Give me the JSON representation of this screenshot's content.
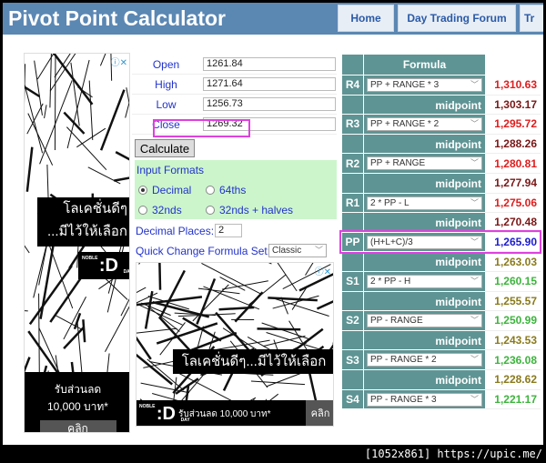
{
  "header": {
    "title": "Pivot Point Calculator",
    "nav": [
      "Home",
      "Day Trading Forum",
      "Tr"
    ]
  },
  "form": {
    "fields": [
      {
        "label": "Open",
        "value": "1261.84"
      },
      {
        "label": "High",
        "value": "1271.64"
      },
      {
        "label": "Low",
        "value": "1256.73"
      },
      {
        "label": "Close",
        "value": "1269.32"
      }
    ],
    "calculate": "Calculate",
    "input_formats": "Input Formats",
    "formats": [
      {
        "label": "Decimal",
        "selected": true
      },
      {
        "label": "64ths",
        "selected": false
      },
      {
        "label": "32nds",
        "selected": false
      },
      {
        "label": "32nds + halves",
        "selected": false
      }
    ],
    "decimal_places_label": "Decimal Places:",
    "decimal_places": "2",
    "formula_set_label": "Quick Change Formula Set:",
    "formula_set": "Classic"
  },
  "pivot": {
    "header": "Formula",
    "rows": [
      {
        "label": "R4",
        "formula": "PP + RANGE * 3",
        "value": "1,310.63",
        "kind": "res"
      },
      {
        "label": "",
        "formula": "midpoint",
        "value": "1,303.17",
        "kind": "midup"
      },
      {
        "label": "R3",
        "formula": "PP + RANGE * 2",
        "value": "1,295.72",
        "kind": "res"
      },
      {
        "label": "",
        "formula": "midpoint",
        "value": "1,288.26",
        "kind": "midup"
      },
      {
        "label": "R2",
        "formula": "PP + RANGE",
        "value": "1,280.81",
        "kind": "res"
      },
      {
        "label": "",
        "formula": "midpoint",
        "value": "1,277.94",
        "kind": "midup"
      },
      {
        "label": "R1",
        "formula": "2 * PP - L",
        "value": "1,275.06",
        "kind": "res"
      },
      {
        "label": "",
        "formula": "midpoint",
        "value": "1,270.48",
        "kind": "midup"
      },
      {
        "label": "PP",
        "formula": "(H+L+C)/3",
        "value": "1,265.90",
        "kind": "pp"
      },
      {
        "label": "",
        "formula": "midpoint",
        "value": "1,263.03",
        "kind": "middn"
      },
      {
        "label": "S1",
        "formula": "2 * PP - H",
        "value": "1,260.15",
        "kind": "sup"
      },
      {
        "label": "",
        "formula": "midpoint",
        "value": "1,255.57",
        "kind": "middn"
      },
      {
        "label": "S2",
        "formula": "PP - RANGE",
        "value": "1,250.99",
        "kind": "sup"
      },
      {
        "label": "",
        "formula": "midpoint",
        "value": "1,243.53",
        "kind": "middn"
      },
      {
        "label": "S3",
        "formula": "PP - RANGE * 2",
        "value": "1,236.08",
        "kind": "sup"
      },
      {
        "label": "",
        "formula": "midpoint",
        "value": "1,228.62",
        "kind": "middn"
      },
      {
        "label": "S4",
        "formula": "PP - RANGE * 3",
        "value": "1,221.17",
        "kind": "sup"
      }
    ]
  },
  "colors": {
    "res": "#e01c1c",
    "midup": "#7a1616",
    "pp": "#1c1ccc",
    "middn": "#8a7a1c",
    "sup": "#3cb43c",
    "teal": "#5f9494",
    "header": "#5b87b3"
  },
  "ads": {
    "left": {
      "headline1": "โลเคชั่นดีๆ",
      "headline2": "...มีไว้ให้เลือก",
      "brand": "NOBLE :D DAY",
      "offer1": "รับส่วนลด",
      "offer2": "10,000 บาท*",
      "cta": "คลิก"
    },
    "bottom": {
      "headline": "โลเคชั่นดีๆ...มีไว้ให้เลือก",
      "brand": "NOBLE :D DAY",
      "offer": "รับส่วนลด 10,000 บาท*",
      "cta": "คลิก"
    }
  },
  "footer": "[1052x861] https://upic.me/"
}
